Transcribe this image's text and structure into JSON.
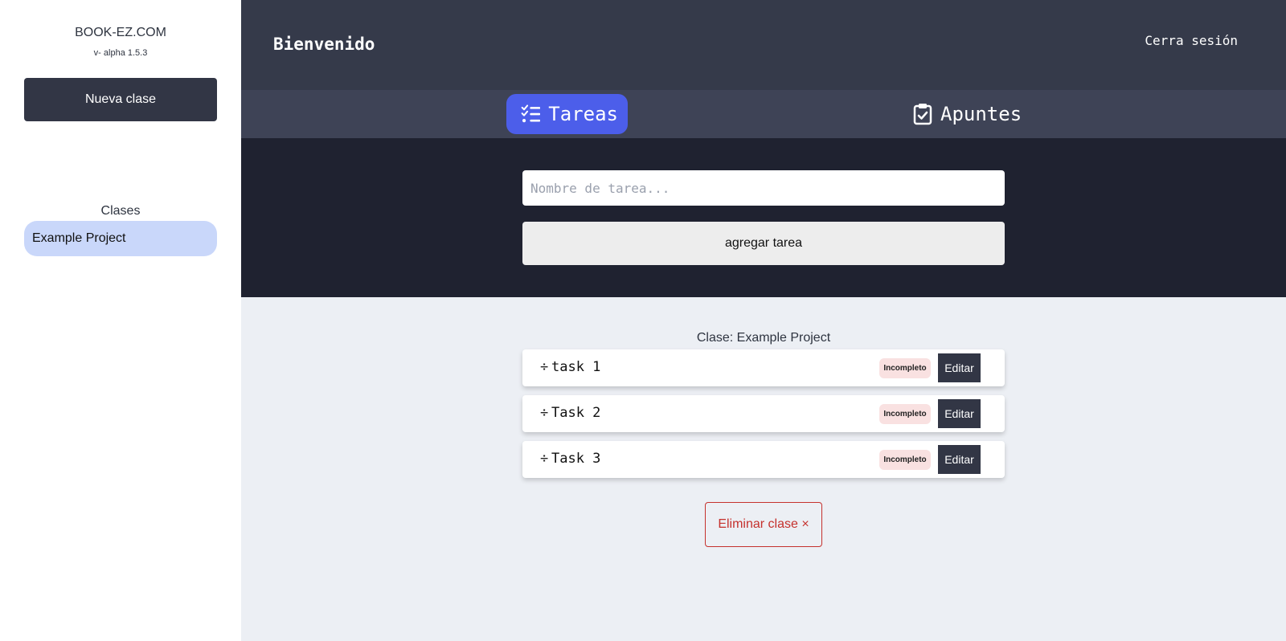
{
  "sidebar": {
    "brand": "BOOK-EZ.COM",
    "version": "v- alpha 1.5.3",
    "new_class_label": "Nueva clase",
    "classes_title": "Clases",
    "classes": [
      {
        "label": "Example Project"
      }
    ]
  },
  "header": {
    "welcome": "Bienvenido",
    "logout": "Cerra sesión"
  },
  "tabs": [
    {
      "label": "Tareas",
      "icon": "checklist-icon",
      "active": true
    },
    {
      "label": "Apuntes",
      "icon": "clipboard-check-icon",
      "active": false
    }
  ],
  "form": {
    "input_placeholder": "Nombre de tarea...",
    "input_value": "",
    "add_label": "agregar tarea"
  },
  "task_list": {
    "title": "Clase: Example Project",
    "drag_symbol": "÷",
    "tasks": [
      {
        "name": "task 1",
        "status": "Incompleto",
        "edit_label": "Editar"
      },
      {
        "name": "Task 2",
        "status": "Incompleto",
        "edit_label": "Editar"
      },
      {
        "name": "Task 3",
        "status": "Incompleto",
        "edit_label": "Editar"
      }
    ]
  },
  "delete_class_label": "Eliminar clase ×",
  "colors": {
    "sidebar_bg": "#ffffff",
    "header_bg": "#353a4a",
    "tabbar_bg": "#3e4356",
    "active_tab": "#4c5eea",
    "form_bg": "#1f2230",
    "main_bg": "#eceff4",
    "selected_class": "#c9d7fa",
    "badge_incomplete": "#f9e1e1",
    "danger": "#c5312d"
  }
}
